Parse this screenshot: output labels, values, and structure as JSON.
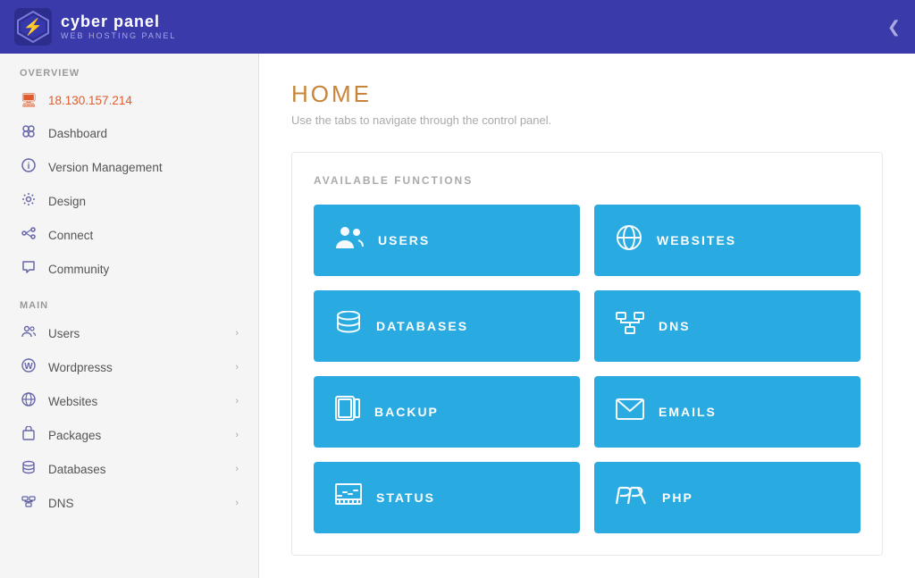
{
  "header": {
    "logo_title": "cyber panel",
    "logo_subtitle": "WEB HOSTING PANEL",
    "toggle_icon": "❮"
  },
  "sidebar": {
    "overview_label": "OVERVIEW",
    "ip_address": "18.130.157.214",
    "overview_items": [
      {
        "id": "dashboard",
        "label": "Dashboard",
        "icon": "🖥"
      },
      {
        "id": "version-management",
        "label": "Version Management",
        "icon": "ℹ"
      },
      {
        "id": "design",
        "label": "Design",
        "icon": "⚙"
      },
      {
        "id": "connect",
        "label": "Connect",
        "icon": "🔗"
      },
      {
        "id": "community",
        "label": "Community",
        "icon": "💬"
      }
    ],
    "main_label": "MAIN",
    "main_items": [
      {
        "id": "users",
        "label": "Users",
        "icon": "👥",
        "has_chevron": true
      },
      {
        "id": "wordpress",
        "label": "Wordpresss",
        "icon": "Ⓦ",
        "has_chevron": true
      },
      {
        "id": "websites",
        "label": "Websites",
        "icon": "🌐",
        "has_chevron": true
      },
      {
        "id": "packages",
        "label": "Packages",
        "icon": "📦",
        "has_chevron": true
      },
      {
        "id": "databases",
        "label": "Databases",
        "icon": "🗄",
        "has_chevron": true
      },
      {
        "id": "dns",
        "label": "DNS",
        "icon": "📡",
        "has_chevron": true
      }
    ]
  },
  "content": {
    "page_title": "HOME",
    "page_subtitle": "Use the tabs to navigate through the control panel.",
    "functions_section_label": "AVAILABLE FUNCTIONS",
    "functions": [
      {
        "id": "users",
        "label": "USERS",
        "icon": "👥"
      },
      {
        "id": "websites",
        "label": "WEBSITES",
        "icon": "🌐"
      },
      {
        "id": "databases",
        "label": "DATABASES",
        "icon": "🗄"
      },
      {
        "id": "dns",
        "label": "DNS",
        "icon": "📡"
      },
      {
        "id": "backup",
        "label": "BACKUP",
        "icon": "📋"
      },
      {
        "id": "emails",
        "label": "EMAILS",
        "icon": "✉"
      },
      {
        "id": "status",
        "label": "STATUS",
        "icon": "📊"
      },
      {
        "id": "php",
        "label": "PHP",
        "icon": "</>"
      }
    ]
  }
}
